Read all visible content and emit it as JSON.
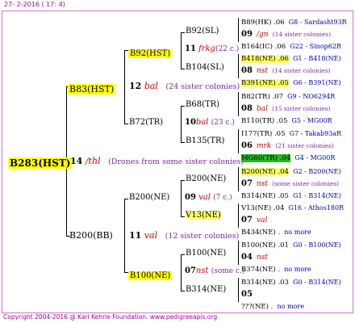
{
  "header": "27-  2-2016 ( 17: 4)",
  "footer": "Copyright 2004-2016 @ Karl Kehrle Foundation.   www.pedigreeapis.org",
  "root": {
    "code": "B283(HST)",
    "gen": "14",
    "frag": "/thl",
    "note": "(Drones from some sister colonies)"
  },
  "g1": [
    {
      "code": "B83(HST)",
      "gen": "12",
      "frag": "bal",
      "note": "(24 sister colonies)"
    },
    {
      "code": "B200(BB)",
      "gen": "11",
      "frag": "val",
      "note": "(12 sister colonies)"
    }
  ],
  "g2": [
    {
      "code": "B92(HST)",
      "gen": "11",
      "frag": "frkg",
      "note": "(22 c.)"
    },
    {
      "code": "B72(TR)",
      "gen": "10",
      "frag": "bal",
      "note": "(23 c.)"
    },
    {
      "code": "B200(NE)",
      "gen": "09",
      "frag": "val",
      "note": "(7 c.)"
    },
    {
      "code": "B100(NE)",
      "gen": "07",
      "frag": "nst",
      "note": "(some c.)"
    }
  ],
  "g3": [
    "B92(SL)",
    "B104(SL)",
    "B68(TR)",
    "B135(TR)",
    "B200(NE)",
    "V13(NE)",
    "B100(NE)",
    "B314(NE)"
  ],
  "g4": [
    {
      "l1": "B89(HK) .06",
      "l1b": "G8 - Sardasht93R",
      "gen": "09",
      "frag": "/gn",
      "note": "(14 sister colonies)",
      "l3": "B164(IC) .06",
      "l3b": "G22 - Sinop62R"
    },
    {
      "l1": "B418(NE) .06",
      "l1b": "G1 - B418(NE)",
      "gen": "08",
      "frag": "nst",
      "note": "(14 sister colonies)",
      "l3": "B391(NE) .05",
      "l3b": "G6 - B391(NE)"
    },
    {
      "l1": "B82(TR) .07",
      "l1b": "G9 - NO6294R",
      "gen": "08",
      "frag": "bal",
      "note": "(15 sister colonies)",
      "l3": "B110(TR) .05",
      "l3b": "G5 - MG00R"
    },
    {
      "l1": "I177(TR) .05",
      "l1b": "G7 - Takab93aR",
      "gen": "06",
      "frag": "mrk",
      "note": "(21 sister colonies)",
      "l3": "MG60(TR) .04",
      "l3b": "G4 - MG00R"
    },
    {
      "l1": "B200(NE) .04",
      "l1b": "G2 - B200(NE)",
      "gen": "07",
      "frag": "nst",
      "note": "(some sister colonies)",
      "l3": "B314(NE) .05",
      "l3b": "G1 - B314(NE)"
    },
    {
      "l1": "V13(NE) .04",
      "l1b": "G16 - Athos180R",
      "gen": "07",
      "frag": "val",
      "note": "",
      "l3": "B434(NE) .",
      "l3b": "no more"
    },
    {
      "l1": "B100(NE) .01",
      "l1b": "G0 - B100(NE)",
      "gen": "04",
      "frag": "nst",
      "note": "",
      "l3": "B374(NE) .",
      "l3b": "no more"
    },
    {
      "l1": "B314(NE) .03",
      "l1b": "G0 - B314(NE)",
      "gen": "05",
      "frag": "",
      "note": "",
      "l3": "???(NE) .",
      "l3b": "no more"
    }
  ]
}
